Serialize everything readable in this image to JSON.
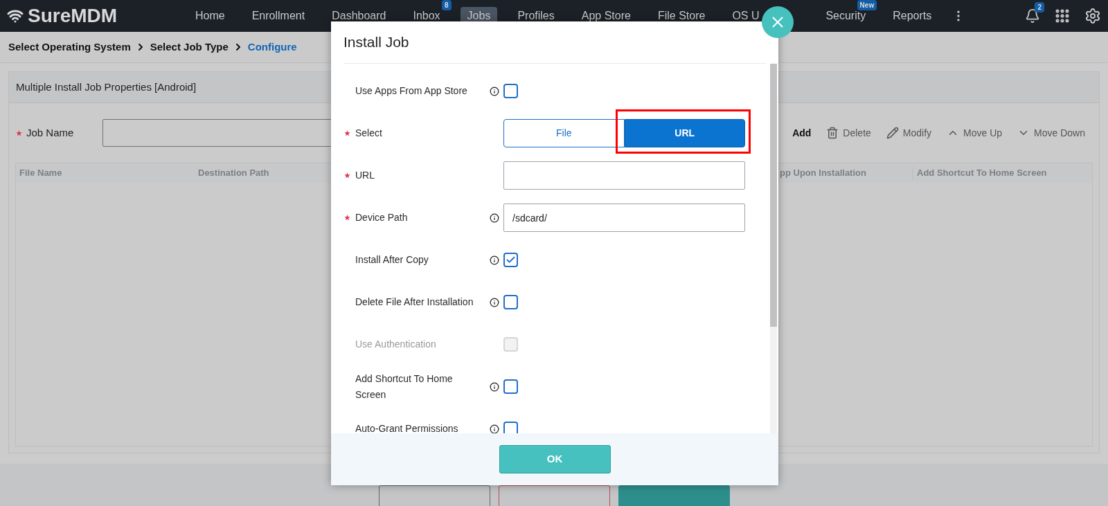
{
  "header": {
    "logo": "SureMDM",
    "nav": [
      {
        "label": "Home",
        "selected": false
      },
      {
        "label": "Enrollment",
        "selected": false
      },
      {
        "label": "Dashboard",
        "selected": false
      },
      {
        "label": "Inbox",
        "selected": false,
        "badge": "8"
      },
      {
        "label": "Jobs",
        "selected": true
      },
      {
        "label": "Profiles",
        "selected": false
      },
      {
        "label": "App Store",
        "selected": false
      },
      {
        "label": "File Store",
        "selected": false
      },
      {
        "label": "OS U",
        "selected": false
      },
      {
        "label": "Security",
        "selected": false,
        "badge": "New"
      },
      {
        "label": "Reports",
        "selected": false
      }
    ],
    "notification_badge": "2"
  },
  "breadcrumb": [
    {
      "label": "Select Operating System",
      "selected": false
    },
    {
      "label": "Select Job Type",
      "selected": false
    },
    {
      "label": "Configure",
      "selected": true
    }
  ],
  "panel": {
    "title": "Multiple Install Job Properties [Android]",
    "job_name_label": "Job Name",
    "toolbar": [
      "Add",
      "Delete",
      "Modify",
      "Move Up",
      "Move Down"
    ],
    "columns": [
      "File Name",
      "Destination Path",
      "pp Upon Installation",
      "Add Shortcut To Home Screen"
    ]
  },
  "dialog": {
    "title": "Install Job",
    "ok": "OK",
    "fields": [
      {
        "kind": "checkbox",
        "label": "Use Apps From App Store",
        "required": false,
        "info": true,
        "checked": false,
        "disabled": false
      },
      {
        "kind": "toggle",
        "label": "Select",
        "required": true,
        "info": false,
        "options": [
          {
            "label": "File",
            "selected": false
          },
          {
            "label": "URL",
            "selected": true
          }
        ]
      },
      {
        "kind": "text",
        "label": "URL",
        "required": true,
        "info": false
      },
      {
        "kind": "text",
        "label": "Device Path",
        "required": true,
        "info": true,
        "value": "/sdcard/"
      },
      {
        "kind": "checkbox",
        "label": "Install After Copy",
        "required": false,
        "info": true,
        "checked": true,
        "disabled": false
      },
      {
        "kind": "checkbox",
        "label": "Delete File After Installation",
        "required": false,
        "info": true,
        "checked": false,
        "disabled": false
      },
      {
        "kind": "checkbox",
        "label": "Use Authentication",
        "required": false,
        "info": false,
        "checked": false,
        "disabled": true
      },
      {
        "kind": "checkbox",
        "label": "Add Shortcut To Home Screen",
        "required": false,
        "info": true,
        "checked": false,
        "disabled": false
      },
      {
        "kind": "checkbox",
        "label": "Auto-Grant Permissions",
        "required": false,
        "info": true,
        "checked": false,
        "disabled": false
      }
    ]
  }
}
